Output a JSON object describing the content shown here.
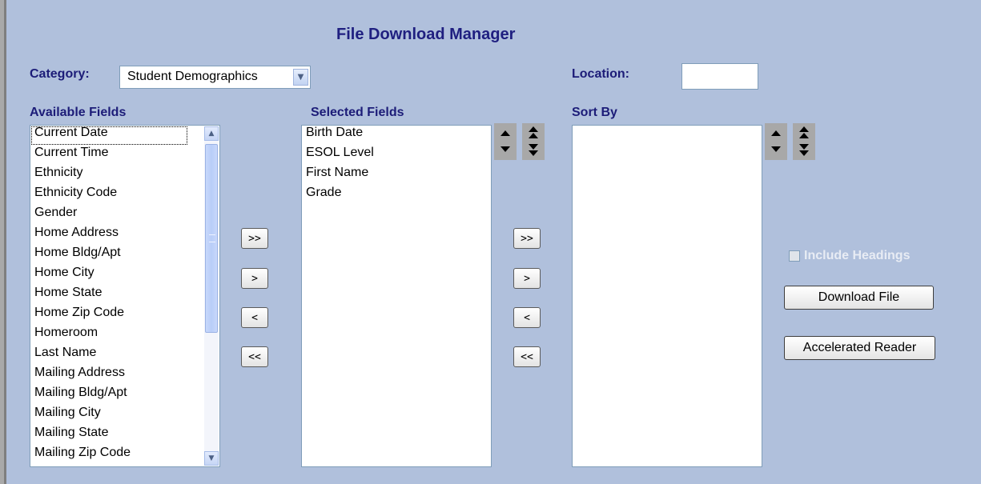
{
  "title": "File Download Manager",
  "category": {
    "label": "Category:",
    "selected": "Student Demographics"
  },
  "location": {
    "label": "Location:",
    "value": ""
  },
  "available": {
    "label": "Available Fields",
    "items": [
      "Current Date",
      "Current Time",
      "Ethnicity",
      "Ethnicity Code",
      "Gender",
      "Home Address",
      "Home Bldg/Apt",
      "Home City",
      "Home State",
      "Home Zip Code",
      "Homeroom",
      "Last Name",
      "Mailing Address",
      "Mailing Bldg/Apt",
      "Mailing City",
      "Mailing State",
      "Mailing Zip Code"
    ]
  },
  "selected": {
    "label": "Selected Fields",
    "items": [
      "Birth Date",
      "ESOL Level",
      "First Name",
      "Grade"
    ]
  },
  "sort_by": {
    "label": "Sort By",
    "items": []
  },
  "move_buttons": {
    "add_all": ">>",
    "add": ">",
    "remove": "<",
    "remove_all": "<<"
  },
  "include_headings": {
    "label": "Include Headings",
    "checked": false
  },
  "download_label": "Download File",
  "accelerated_reader_label": "Accelerated Reader"
}
